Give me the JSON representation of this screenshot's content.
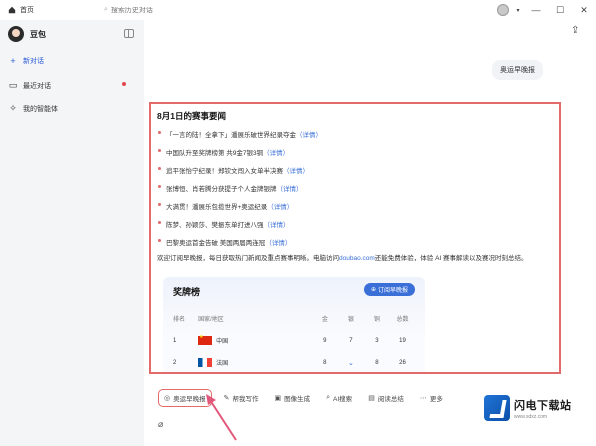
{
  "window": {
    "tab_title": "首页",
    "search_placeholder": "搜索历史对话"
  },
  "sidebar": {
    "brand_name": "豆包",
    "items": [
      {
        "label": "新对话",
        "icon": "plus-icon"
      },
      {
        "label": "最近对话",
        "icon": "chat-icon"
      },
      {
        "label": "我的智能体",
        "icon": "sparkle-icon"
      }
    ]
  },
  "conversation": {
    "user_message": "奥运早晚报",
    "answer": {
      "heading": "8月1日的赛事要闻",
      "bullets": [
        {
          "text": "「一言的陆！全拿下」潘展乐破世界纪录夺金",
          "link": "（详情）"
        },
        {
          "text": "中国队升至奖牌榜第 共9金7银3铜",
          "link": "（详情）"
        },
        {
          "text": "追平张怡宁纪录！郑钦文闯入女单半决赛",
          "link": "（详情）"
        },
        {
          "text": "张博恒、肖若腾分获提子个人金牌银牌",
          "link": "（详情）"
        },
        {
          "text": "大满贯！潘展乐包揽世界+奥运纪录",
          "link": "（详情）"
        },
        {
          "text": "陈梦、孙颖莎、樊振东单打进八强",
          "link": "（详情）"
        },
        {
          "text": "巴黎奥运首金告破 美国两届两连冠",
          "link": "（详情）"
        }
      ],
      "summary_before": "欢迎订阅早晚报，每日获取热门新闻及重点赛事明晰。电脑访问",
      "summary_link": "doubao.com",
      "summary_after": "还能免费体验，体验 AI 赛事解读以及赛况时刻总结。"
    },
    "medal_table": {
      "title": "奖牌榜",
      "subscribe_label": "订阅早晚报",
      "headers": {
        "rank": "排名",
        "country": "国家/地区",
        "gold": "金",
        "silver": "银",
        "bronze": "铜",
        "total": "总数"
      },
      "rows": [
        {
          "rank": "1",
          "country": "中国",
          "gold": "9",
          "silver": "7",
          "bronze": "3",
          "total": "19",
          "flag": "cn"
        },
        {
          "rank": "2",
          "country": "法国",
          "gold": "8",
          "silver": "",
          "bronze": "8",
          "total": "26",
          "flag": "fr"
        }
      ]
    }
  },
  "toolbar": {
    "tools": [
      {
        "label": "奥运早晚报",
        "icon": "subscribe-icon"
      },
      {
        "label": "帮我写作",
        "icon": "pen-icon"
      },
      {
        "label": "图像生成",
        "icon": "image-icon"
      },
      {
        "label": "AI搜索",
        "icon": "search-icon"
      },
      {
        "label": "阅读总结",
        "icon": "doc-icon"
      },
      {
        "label": "更多",
        "icon": "more-icon"
      }
    ]
  },
  "watermark": {
    "name": "闪电下载站",
    "url": "www.sdxz.com"
  },
  "colors": {
    "accent": "#3a6fd8",
    "highlight_border": "#e26a6a",
    "sidebar_bg": "#f4f5f7"
  }
}
